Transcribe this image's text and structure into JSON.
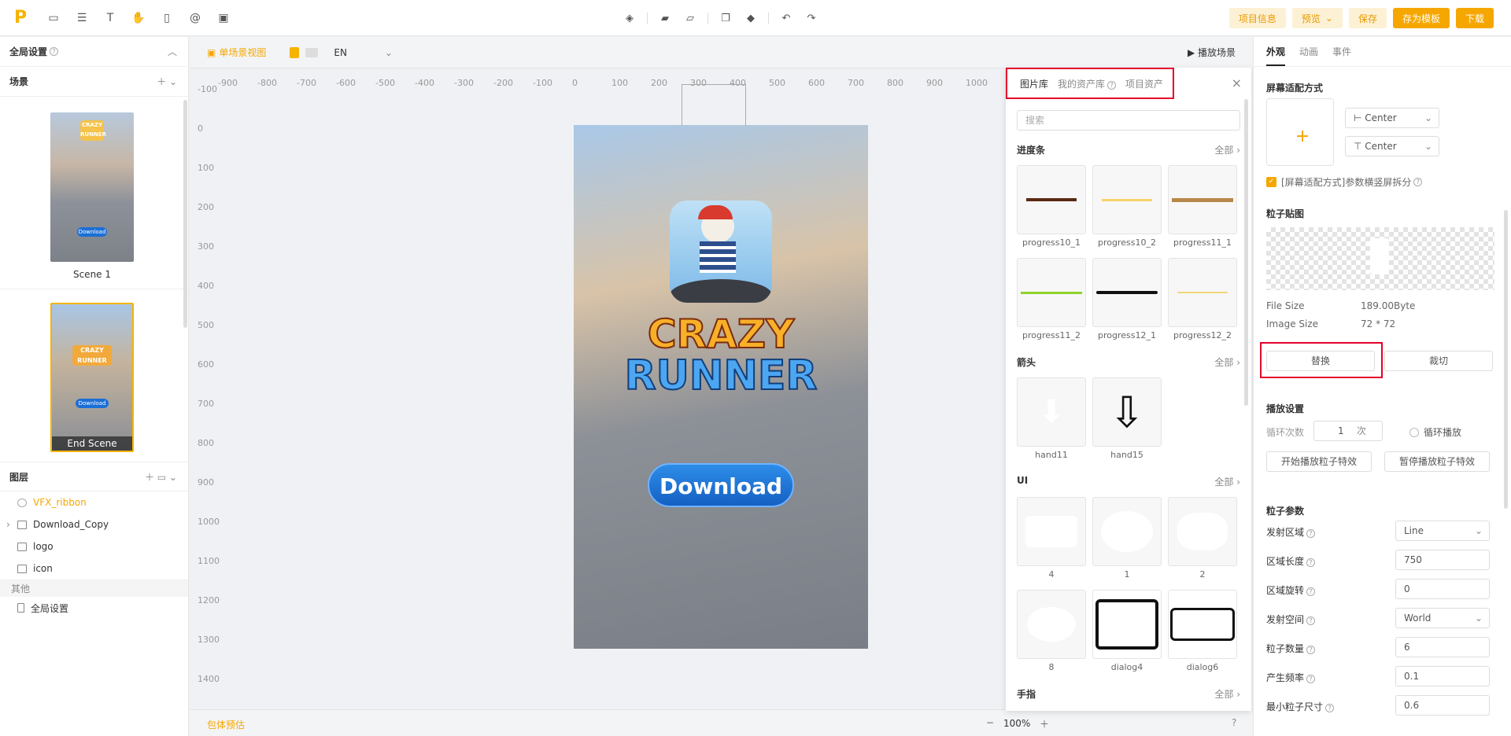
{
  "toolbar": {
    "logo": "P",
    "project_info": "项目信息",
    "preview": "预览",
    "save": "保存",
    "save_template": "存为模板",
    "download": "下载"
  },
  "left": {
    "global_settings": "全局设置",
    "scenes_title": "场景",
    "scene1_label": "Scene 1",
    "scene2_label": "End Scene",
    "scene1_download": "Download",
    "scene2_download": "Download",
    "layers_title": "图层",
    "layers": [
      "VFX_ribbon",
      "Download_Copy",
      "logo",
      "icon"
    ],
    "other_title": "其他",
    "other_item": "全局设置"
  },
  "canvas": {
    "view_label": "单场景视图",
    "lang": "EN",
    "play_scene": "播放场景",
    "bottom_left": "包体预估",
    "zoom": "100%",
    "ruler_top": [
      "-900",
      "-800",
      "-700",
      "-600",
      "-500",
      "-400",
      "-300",
      "-200",
      "-100",
      "0",
      "100",
      "200",
      "300",
      "400",
      "500",
      "600",
      "700",
      "800",
      "900",
      "1000"
    ],
    "ruler_left": [
      "-100",
      "0",
      "100",
      "200",
      "300",
      "400",
      "500",
      "600",
      "700",
      "800",
      "900",
      "1000",
      "1100",
      "1200",
      "1300",
      "1400"
    ],
    "game_title_top": "CRAZY",
    "game_title_bottom": "RUNNER",
    "download_button": "Download"
  },
  "assets": {
    "tab_library": "图片库",
    "tab_my_assets": "我的资产库",
    "tab_project_assets": "项目资产",
    "search_placeholder": "搜索",
    "all_label": "全部",
    "cat_progress": "进度条",
    "progress": [
      "progress10_1",
      "progress10_2",
      "progress11_1",
      "progress11_2",
      "progress12_1",
      "progress12_2"
    ],
    "cat_arrow": "箭头",
    "arrows": [
      "hand11",
      "hand15"
    ],
    "cat_ui": "UI",
    "ui": [
      "4",
      "1",
      "2",
      "8",
      "dialog4",
      "dialog6"
    ],
    "cat_finger": "手指"
  },
  "right": {
    "tab_appearance": "外观",
    "tab_animation": "动画",
    "tab_event": "事件",
    "screen_fit": "屏幕适配方式",
    "h_align": "Center",
    "v_align": "Center",
    "fit_checkbox": "[屏幕适配方式]参数横竖屏拆分",
    "particle_texture": "粒子贴图",
    "file_size_label": "File Size",
    "file_size": "189.00Byte",
    "image_size_label": "Image Size",
    "image_size": "72 * 72",
    "replace": "替换",
    "crop": "裁切",
    "play_settings": "播放设置",
    "loop_count_label": "循环次数",
    "loop_count": "1",
    "loop_unit": "次",
    "loop_play": "循环播放",
    "start_particle": "开始播放粒子特效",
    "pause_particle": "暂停播放粒子特效",
    "particle_params": "粒子参数",
    "params": [
      {
        "label": "发射区域",
        "value": "Line",
        "type": "select"
      },
      {
        "label": "区域长度",
        "value": "750",
        "type": "input"
      },
      {
        "label": "区域旋转",
        "value": "0",
        "type": "input"
      },
      {
        "label": "发射空间",
        "value": "World",
        "type": "select"
      },
      {
        "label": "粒子数量",
        "value": "6",
        "type": "input"
      },
      {
        "label": "产生频率",
        "value": "0.1",
        "type": "input"
      },
      {
        "label": "最小粒子尺寸",
        "value": "0.6",
        "type": "input"
      }
    ]
  },
  "colors": {
    "accent": "#f5a700",
    "highlight": "#e4002b",
    "blue": "#1560c3"
  }
}
